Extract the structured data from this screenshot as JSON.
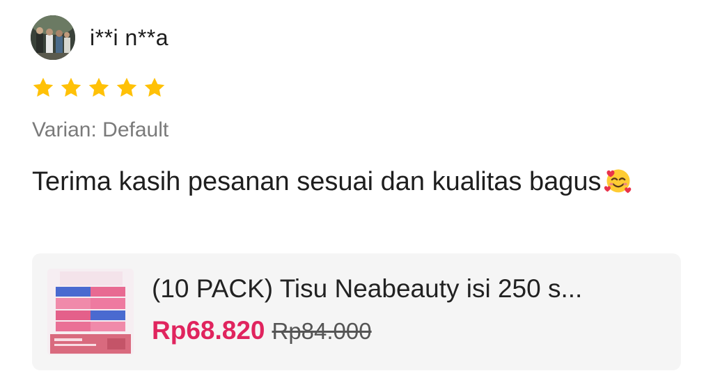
{
  "reviewer": {
    "name": "i**i n**a",
    "avatar_icon": "user-photo-avatar"
  },
  "rating": {
    "value": 5,
    "max": 5,
    "star_color": "#FFC107"
  },
  "variant": {
    "text": "Varian: Default"
  },
  "review": {
    "text": "Terima kasih pesanan sesuai dan kualitas bagus",
    "emoji": "smiling-face-with-hearts"
  },
  "product": {
    "title": "(10 PACK) Tisu Neabeauty isi 250 s...",
    "price": "Rp68.820",
    "original_price": "Rp84.000",
    "price_color": "#E0245E",
    "thumbnail_icon": "tissue-pack-image"
  }
}
